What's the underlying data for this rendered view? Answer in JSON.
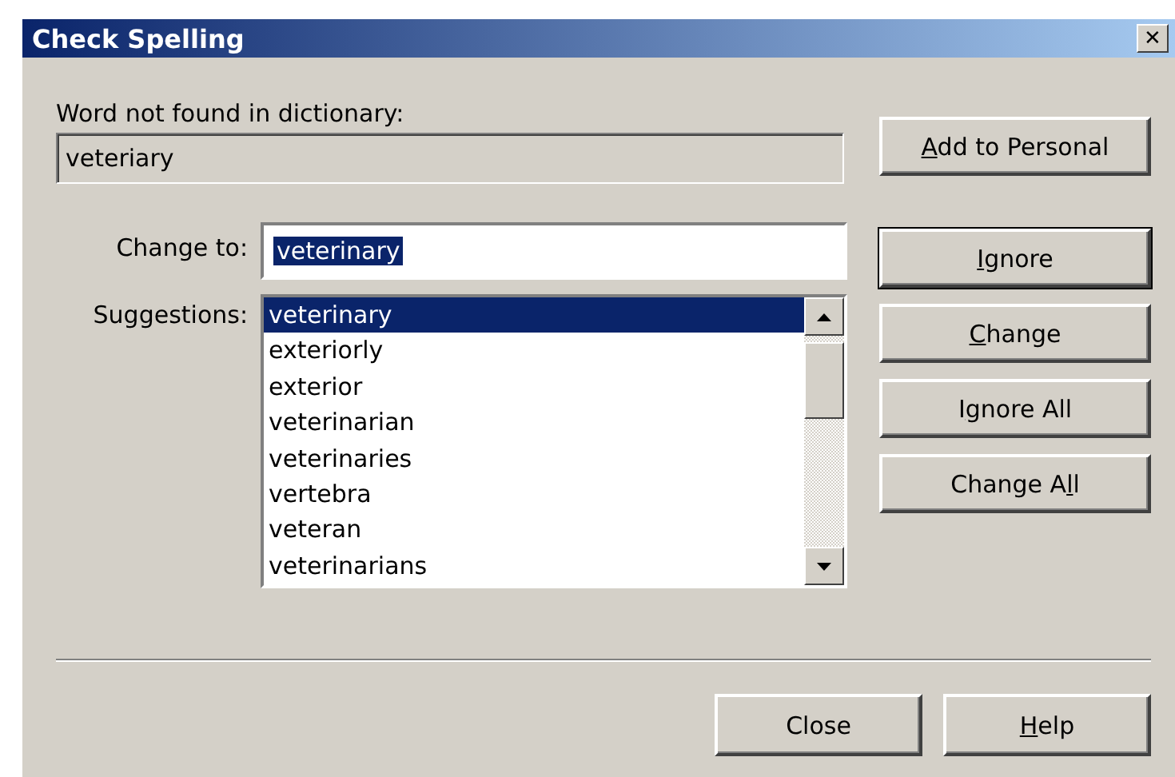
{
  "window": {
    "title": "Check Spelling",
    "close_glyph": "✕"
  },
  "not_found": {
    "label": "Word not found in dictionary:",
    "value": "veteriary"
  },
  "change_to": {
    "label": "Change to:",
    "value": "veterinary",
    "selected": true
  },
  "suggestions": {
    "label": "Suggestions:",
    "items": [
      {
        "text": "veterinary",
        "selected": true
      },
      {
        "text": "exteriorly",
        "selected": false
      },
      {
        "text": "exterior",
        "selected": false
      },
      {
        "text": "veterinarian",
        "selected": false
      },
      {
        "text": "veterinaries",
        "selected": false
      },
      {
        "text": "vertebra",
        "selected": false
      },
      {
        "text": "veteran",
        "selected": false
      },
      {
        "text": "veterinarians",
        "selected": false
      }
    ]
  },
  "add_button": {
    "key": "A",
    "post": "dd to Personal"
  },
  "action_buttons": [
    {
      "key": "I",
      "post": "gnore",
      "default": true
    },
    {
      "key": "C",
      "post": "hange",
      "default": false
    },
    {
      "pre": "I",
      "key": "g",
      "post": "nore All",
      "default": false
    },
    {
      "pre": "Change A",
      "key": "l",
      "post": "l",
      "default": false
    }
  ],
  "bottom_buttons": [
    {
      "pre": "Close"
    },
    {
      "key": "H",
      "post": "elp"
    }
  ]
}
